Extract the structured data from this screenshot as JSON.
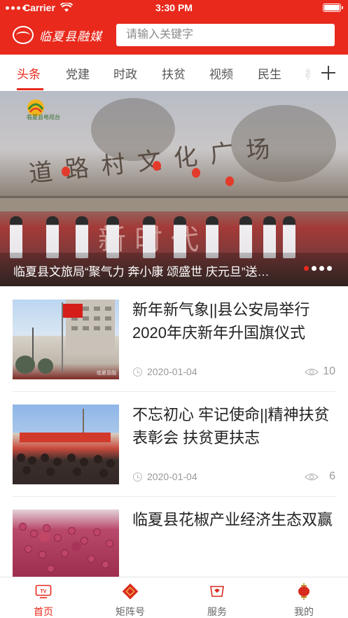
{
  "status_bar": {
    "carrier": "Carrier",
    "time": "3:30 PM"
  },
  "header": {
    "logo_text": "临夏县融媒",
    "search_placeholder": "请输入关键字"
  },
  "tabs": [
    {
      "label": "头条",
      "active": true
    },
    {
      "label": "党建",
      "active": false
    },
    {
      "label": "时政",
      "active": false
    },
    {
      "label": "扶贫",
      "active": false
    },
    {
      "label": "视频",
      "active": false
    },
    {
      "label": "民生",
      "active": false
    },
    {
      "label": "教",
      "active": false
    }
  ],
  "banner": {
    "caption": "临夏县文旅局“聚气力 奔小康 颂盛世 庆元旦”送…",
    "page_count": 4,
    "active_page": 1,
    "tv_logo_text": "临夏县电视台",
    "arch_text": "道路村文化广场",
    "stage_text": "新时代"
  },
  "news": [
    {
      "title": "新年新气象||县公安局举行2020年庆新年升国旗仪式",
      "date": "2020-01-04",
      "views": "10",
      "thumb": "flag-raising-photo",
      "watermark": "临夏县融"
    },
    {
      "title": "不忘初心 牢记使命||精神扶贫表彰会 扶贫更扶志",
      "date": "2020-01-04",
      "views": "6",
      "thumb": "crowd-meeting-photo"
    },
    {
      "title": "临夏县花椒产业经济生态双赢",
      "thumb": "pepper-harvest-photo"
    }
  ],
  "tabbar": [
    {
      "label": "首页",
      "icon": "tv-icon",
      "active": true
    },
    {
      "label": "矩阵号",
      "icon": "fu-icon",
      "active": false
    },
    {
      "label": "服务",
      "icon": "service-icon",
      "active": false
    },
    {
      "label": "我的",
      "icon": "lantern-icon",
      "active": false
    }
  ],
  "colors": {
    "brand_red": "#e8291c",
    "text_dark": "#222222",
    "text_muted": "#999999"
  }
}
